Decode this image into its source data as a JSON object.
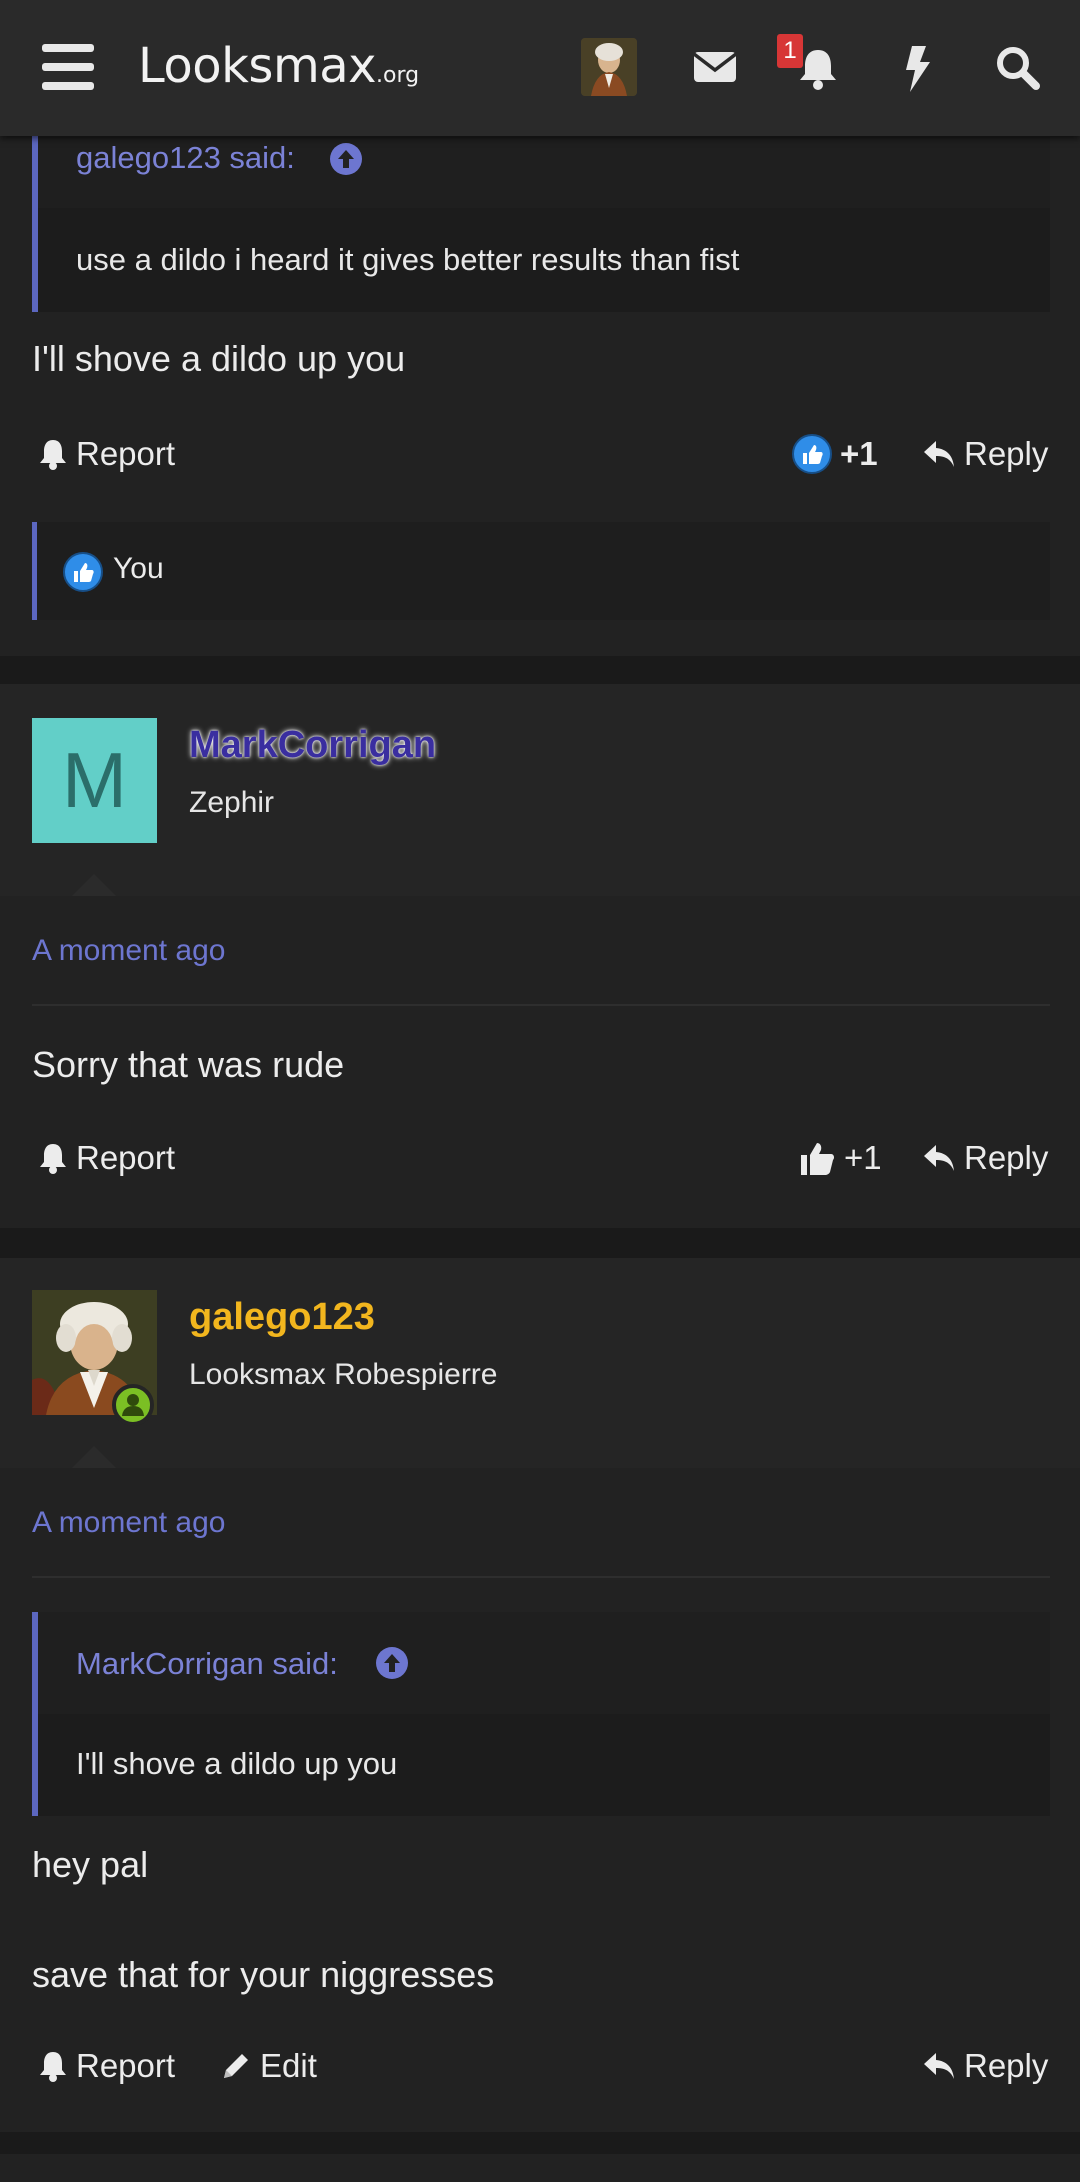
{
  "header": {
    "logo_main": "Looksmax",
    "logo_suffix": ".org",
    "notification_count": "1",
    "icons": [
      "menu-icon",
      "avatar",
      "envelope-icon",
      "bell-icon",
      "bolt-icon",
      "search-icon"
    ]
  },
  "posts": [
    {
      "quote_author": "galego123 said:",
      "quote_text": "use a dildo i heard it gives better results than fist",
      "body": "I'll shove a dildo up you",
      "report_label": "Report",
      "reaction_count": "+1",
      "reply_label": "Reply",
      "reactions_list": "You"
    },
    {
      "username": "MarkCorrigan",
      "avatar_letter": "M",
      "user_title": "Zephir",
      "time": "A moment ago",
      "body": "Sorry that was rude",
      "report_label": "Report",
      "reaction_count": "+1",
      "reply_label": "Reply"
    },
    {
      "username": "galego123",
      "user_title": "Looksmax Robespierre",
      "time": "A moment ago",
      "quote_author": "MarkCorrigan said:",
      "quote_text": "I'll shove a dildo up you",
      "body_line1": "hey pal",
      "body_line2": "save that for your niggresses",
      "report_label": "Report",
      "edit_label": "Edit",
      "reply_label": "Reply"
    }
  ],
  "colors": {
    "accent": "#6d76d0",
    "markcorrigan_name": "#3a2ea0",
    "galego_name": "#f2b61e",
    "avatar_teal": "#62cfc8",
    "like_blue": "#2f8de8",
    "online_green": "#7bbf24",
    "badge_red": "#d73636"
  }
}
